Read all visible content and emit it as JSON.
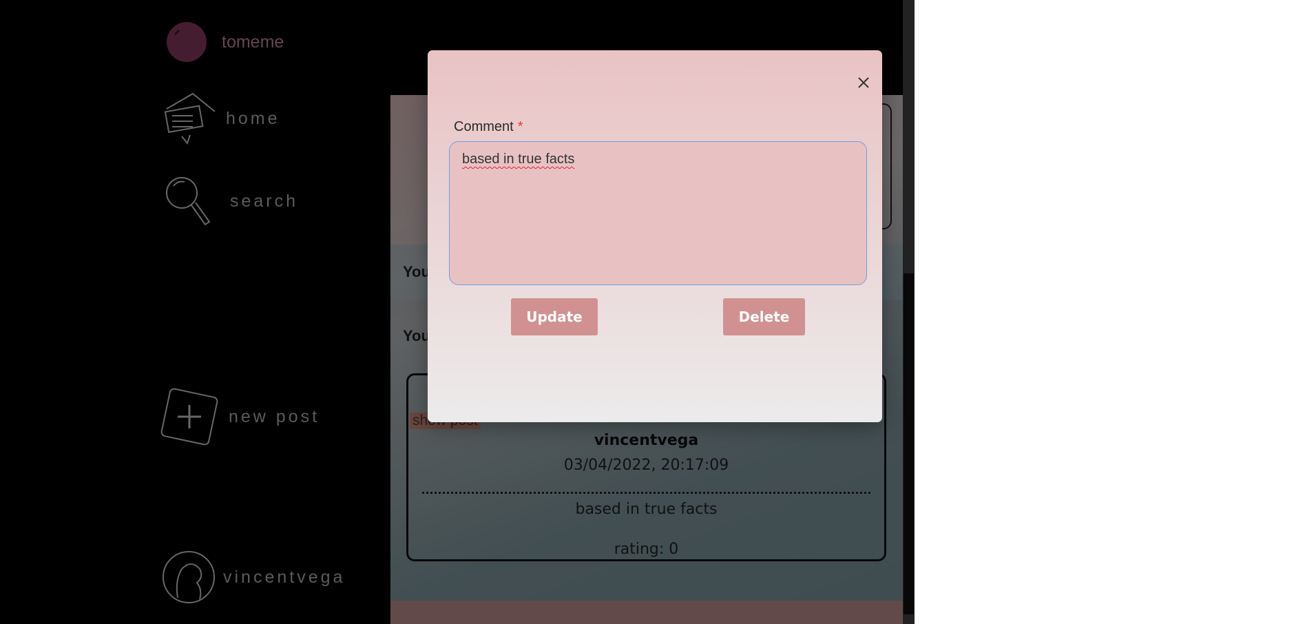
{
  "sidebar": {
    "brand": "tomeme",
    "items": [
      {
        "label": "home"
      },
      {
        "label": "search"
      },
      {
        "label": "new post"
      },
      {
        "label": "vincentvega"
      }
    ]
  },
  "main": {
    "section_prefix_1": "You",
    "section_prefix_2": "You",
    "post": {
      "show_post_label": "show post",
      "author": "vincentvega",
      "date": "03/04/2022, 20:17:09",
      "text": "based in true facts",
      "rating": "rating: 0"
    }
  },
  "modal": {
    "field_label": "Comment",
    "required_mark": "*",
    "comment_value": "based in true facts",
    "update_label": "Update",
    "delete_label": "Delete"
  },
  "colors": {
    "modal_top": "#e9c3c4",
    "button": "#d19191",
    "brand": "#c78c9c",
    "focus_border": "#6f9ee0"
  }
}
